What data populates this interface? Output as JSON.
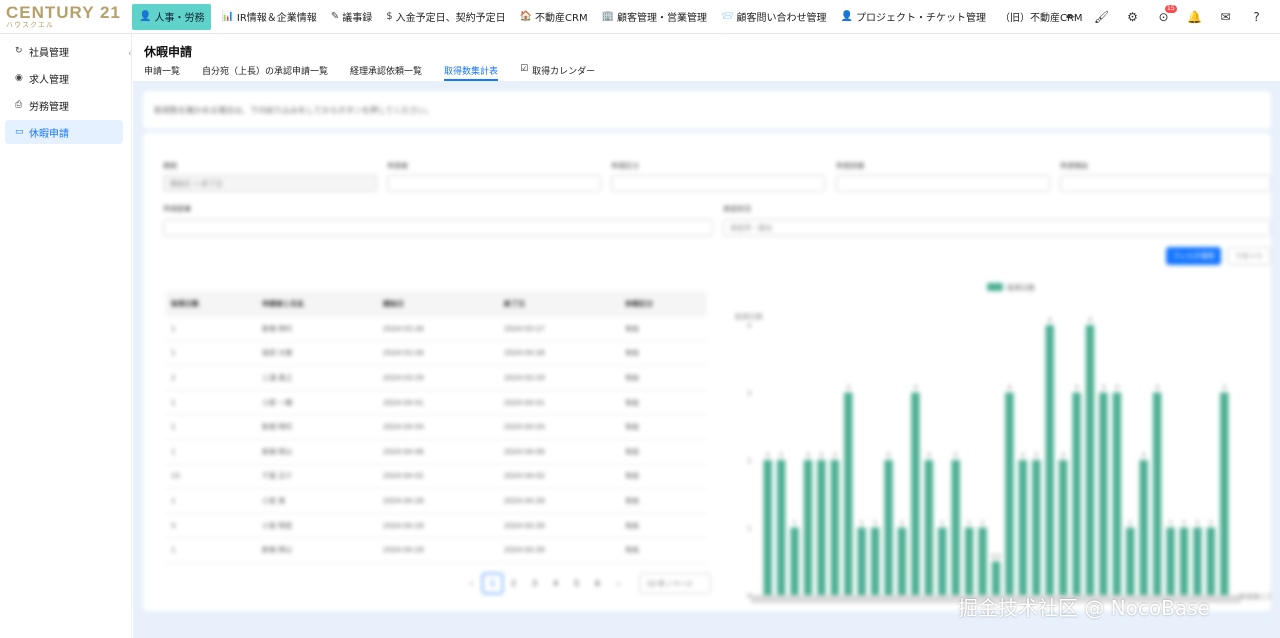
{
  "brand": {
    "name": "CENTURY 21",
    "sub": "ハウスクエル"
  },
  "topnav": [
    {
      "label": "人事・労務",
      "icon": "person-icon",
      "glyph": "👤",
      "active": true
    },
    {
      "label": "IR情報＆企業情報",
      "icon": "bar-chart-icon",
      "glyph": "📊",
      "active": false
    },
    {
      "label": "議事録",
      "icon": "edit-icon",
      "glyph": "✎",
      "active": false
    },
    {
      "label": "入金予定日、契約予定日",
      "icon": "dollar-icon",
      "glyph": "$",
      "active": false
    },
    {
      "label": "不動産CRM",
      "icon": "house-icon",
      "glyph": "🏠",
      "active": false
    },
    {
      "label": "顧客管理・営業管理",
      "icon": "office-icon",
      "glyph": "🏢",
      "active": false
    },
    {
      "label": "顧客問い合わせ管理",
      "icon": "inbox-icon",
      "glyph": "📨",
      "active": false
    },
    {
      "label": "プロジェクト・チケット管理",
      "icon": "person-icon",
      "glyph": "👤",
      "active": false
    },
    {
      "label": "（旧）不動産CRM",
      "icon": "",
      "glyph": "",
      "active": false
    }
  ],
  "actions": [
    {
      "icon": "pen-icon",
      "glyph": "✒"
    },
    {
      "icon": "brush-icon",
      "glyph": "🖌"
    },
    {
      "icon": "gear-icon",
      "glyph": "⚙"
    },
    {
      "icon": "check-circle-icon",
      "glyph": "⊙",
      "badge": "15"
    },
    {
      "icon": "bell-icon",
      "glyph": "🔔"
    },
    {
      "icon": "mail-icon",
      "glyph": "✉"
    },
    {
      "icon": "help-icon",
      "glyph": "?"
    }
  ],
  "sidebar": [
    {
      "label": "社員管理",
      "icon": "clock-icon",
      "glyph": "↻",
      "active": false
    },
    {
      "label": "求人管理",
      "icon": "github-icon",
      "glyph": "◉",
      "active": false
    },
    {
      "label": "労務管理",
      "icon": "printer-icon",
      "glyph": "⎙",
      "active": false
    },
    {
      "label": "休暇申請",
      "icon": "folder-icon",
      "glyph": "▭",
      "active": true
    }
  ],
  "page": {
    "title": "休暇申請",
    "tabs": [
      {
        "label": "申請一覧",
        "active": false,
        "glyph": ""
      },
      {
        "label": "自分宛（上長）の承認申請一覧",
        "active": false,
        "glyph": ""
      },
      {
        "label": "経理承認依頼一覧",
        "active": false,
        "glyph": ""
      },
      {
        "label": "取得数集計表",
        "active": true,
        "glyph": ""
      },
      {
        "label": "取得カレンダー",
        "active": false,
        "glyph": "☑"
      }
    ]
  },
  "content": {
    "notice": "取得数を確かめる場合は、下の絞り込みをしてからボタンを押してください。",
    "filters": {
      "f1": {
        "label": "期間",
        "value": "開始日 → 終了日"
      },
      "f2": {
        "label": "申請者",
        "value": ""
      },
      "f3": {
        "label": "申請区分",
        "value": ""
      },
      "f4": {
        "label": "申請詳細",
        "value": ""
      },
      "f5": {
        "label": "申請理由",
        "value": ""
      },
      "f6": {
        "label": "申請部署",
        "value": ""
      },
      "f7": {
        "label": "承認状況",
        "value": "承認済・提出"
      }
    },
    "search_btn": "フィルタ適用",
    "reset_btn": "リセット",
    "table": {
      "headers": [
        "取得日数",
        "申請者と氏名",
        "開始日",
        "終了日",
        "休暇区分"
      ],
      "rows": [
        [
          "1",
          "新規 明代",
          "2024-03-26",
          "2024-03-27",
          "有給"
        ],
        [
          "1",
          "坂田 大樹",
          "2024-03-28",
          "2024-04-28",
          "有給"
        ],
        [
          "2",
          "三浦 貴之",
          "2024-03-29",
          "2024-03-29",
          "有給"
        ],
        [
          "1",
          "小原 一輝",
          "2024-04-01",
          "2024-04-01",
          "有給"
        ],
        [
          "1",
          "新規 明代",
          "2024-04-04",
          "2024-04-04",
          "有給"
        ],
        [
          "1",
          "新規 明公",
          "2024-04-06",
          "2024-04-06",
          "有給"
        ],
        [
          "15",
          "千葉 正介",
          "2024-04-02",
          "2024-04-02",
          "有給"
        ],
        [
          "1",
          "小宮 香",
          "2024-04-28",
          "2024-04-28",
          "有給"
        ],
        [
          "3",
          "小宮 明宏",
          "2024-04-28",
          "2024-04-28",
          "有給"
        ],
        [
          "1",
          "新規 明公",
          "2024-04-28",
          "2024-04-28",
          "有給"
        ]
      ]
    },
    "pagination": {
      "pages": [
        "1",
        "2",
        "3",
        "4",
        "5",
        "6"
      ],
      "current": "1",
      "prev": "‹",
      "next": "›",
      "size_label": "10 件 / ページ"
    }
  },
  "chart_data": {
    "type": "bar",
    "legend": "取得日数",
    "legend_position": "top",
    "ylabel": "取得日数",
    "xlabel": "申請者と氏名",
    "ylim": [
      0,
      4
    ],
    "yticks": [
      0,
      1,
      2,
      3,
      4
    ],
    "bar_color": "#4caf93",
    "values": [
      2,
      2,
      1,
      2,
      2,
      2,
      3,
      1,
      1,
      2,
      1,
      3,
      2,
      1,
      2,
      1,
      1,
      0.5,
      3,
      2,
      2,
      4,
      2,
      3,
      4,
      3,
      3,
      1,
      2,
      3,
      1,
      1,
      1,
      1,
      3
    ]
  },
  "watermark": "掘金技术社区 @ NocoBase"
}
